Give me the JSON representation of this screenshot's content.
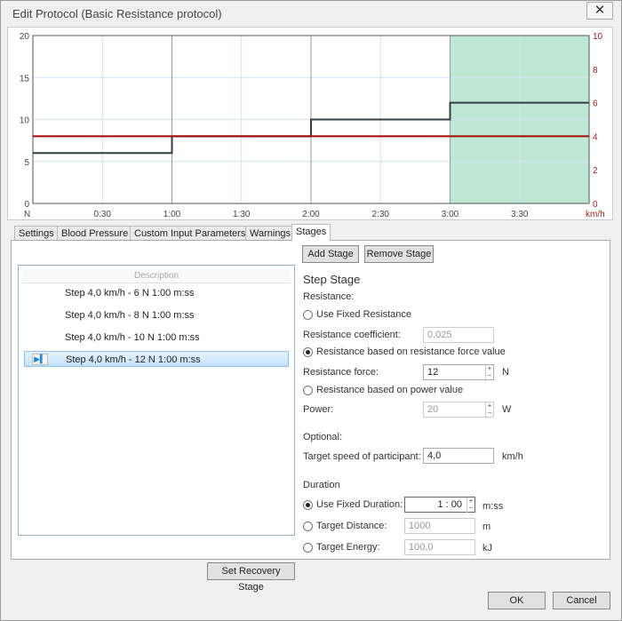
{
  "window": {
    "title": "Edit Protocol (Basic Resistance protocol)",
    "close": "✕"
  },
  "chart_data": {
    "type": "line",
    "x_ticks": [
      "0:30",
      "1:00",
      "1:30",
      "2:00",
      "2:30",
      "3:00",
      "3:30"
    ],
    "xlim_seconds": [
      0,
      240
    ],
    "left_axis": {
      "label": "N",
      "ylim": [
        0,
        20
      ],
      "ticks": [
        "0",
        "5",
        "10",
        "15",
        "20"
      ]
    },
    "right_axis": {
      "label": "km/h",
      "ylim": [
        0,
        10
      ],
      "ticks": [
        "0",
        "2",
        "4",
        "6",
        "8",
        "10"
      ],
      "color": "#9b1c1c"
    },
    "series": [
      {
        "axis": "left",
        "color": "#2f4040",
        "step": true,
        "x_seconds": [
          0,
          60,
          120,
          180,
          240
        ],
        "values": [
          6,
          8,
          10,
          12
        ]
      },
      {
        "axis": "right",
        "color": "#a00000",
        "x_seconds": [
          0,
          240
        ],
        "values": [
          4,
          4
        ]
      }
    ],
    "highlight": {
      "from_seconds": 180,
      "to_seconds": 240,
      "color": "#bfe8d4"
    },
    "grid": true
  },
  "tabs": [
    "Settings",
    "Blood Pressure",
    "Custom Input Parameters",
    "Warnings",
    "Stages"
  ],
  "active_tab": "Stages",
  "list": {
    "header": "Description",
    "items": [
      "Step 4,0 km/h - 6 N 1:00 m:ss",
      "Step 4,0 km/h - 8 N 1:00 m:ss",
      "Step 4,0 km/h - 10 N 1:00 m:ss",
      "Step 4,0 km/h - 12 N 1:00 m:ss"
    ],
    "selected": 3
  },
  "buttons": {
    "add": "Add Stage",
    "remove": "Remove Stage",
    "recovery": "Set Recovery Stage",
    "ok": "OK",
    "cancel": "Cancel"
  },
  "stage": {
    "title": "Step Stage",
    "resistance": "Resistance:",
    "fixed": "Use Fixed Resistance",
    "coef_label": "Resistance coefficient:",
    "coef": "0,025",
    "force_radio": "Resistance based on resistance force value",
    "force_label": "Resistance force:",
    "force": "12",
    "force_unit": "N",
    "power_radio": "Resistance based on power value",
    "power_label": "Power:",
    "power": "20",
    "power_unit": "W",
    "optional": "Optional:",
    "speed_label": "Target speed of participant:",
    "speed": "4,0",
    "speed_unit": "km/h",
    "duration": "Duration",
    "fixed_dur": "Use Fixed Duration:",
    "dur": "1 : 00",
    "dur_unit": "m:ss",
    "dist_label": "Target Distance:",
    "dist": "1000",
    "dist_unit": "m",
    "energy_label": "Target Energy:",
    "energy": "100,0",
    "energy_unit": "kJ"
  }
}
